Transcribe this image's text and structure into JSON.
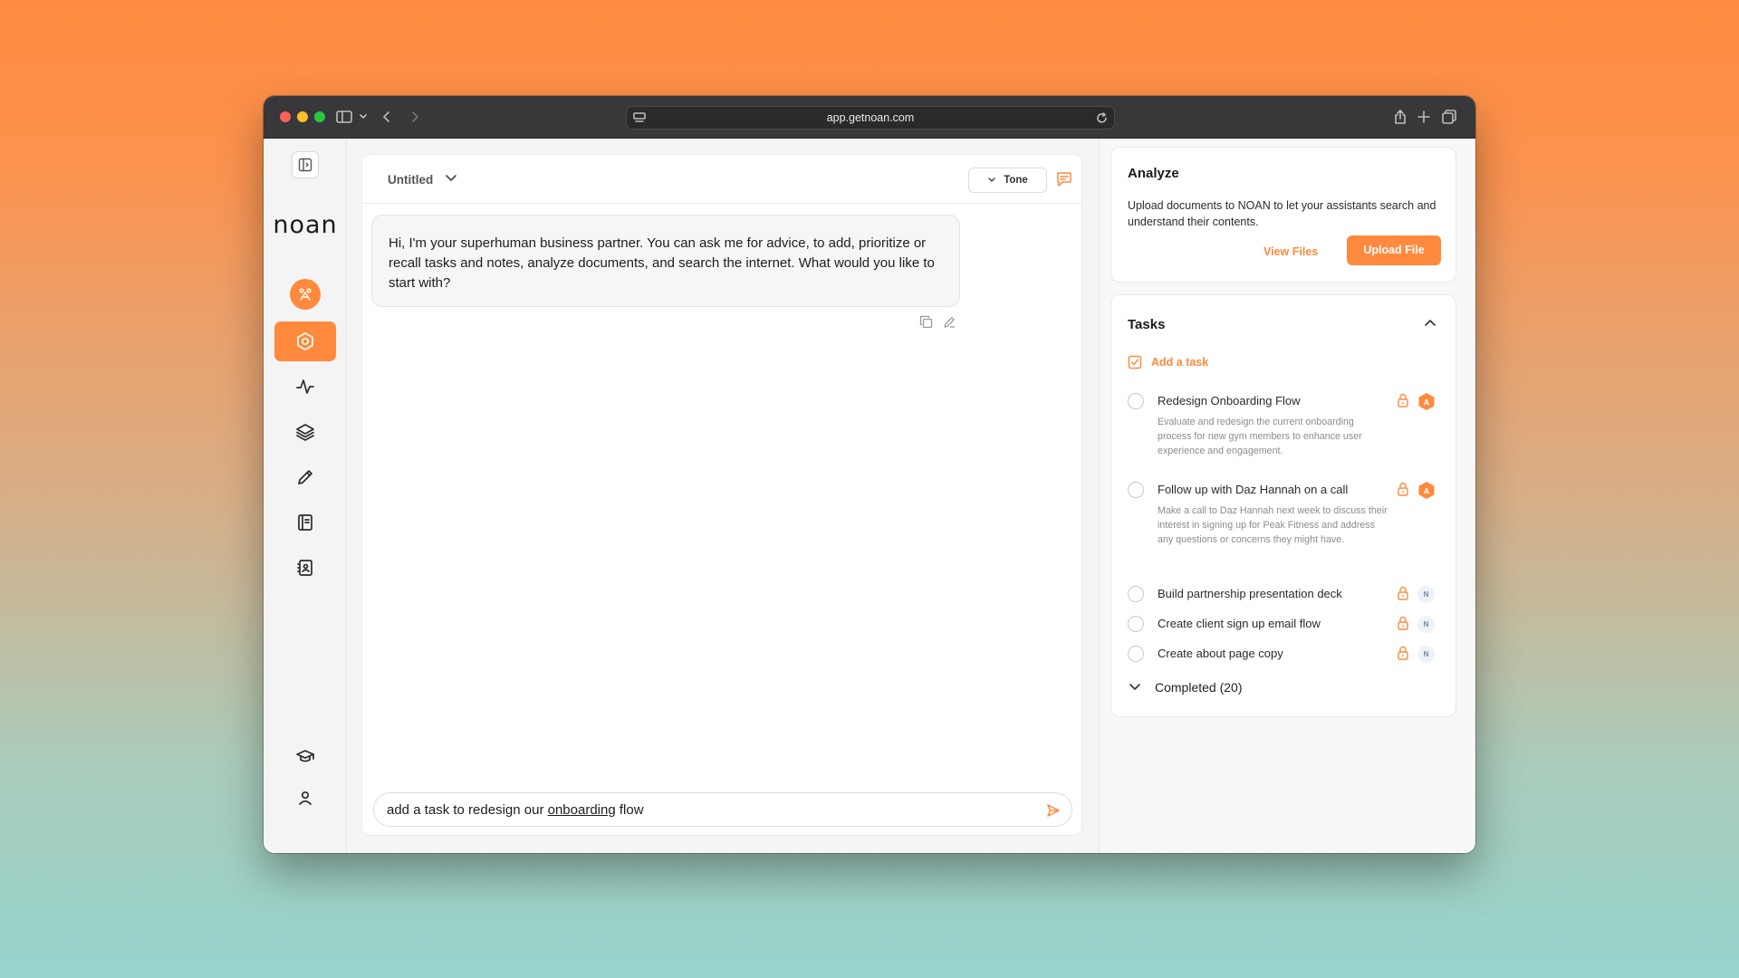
{
  "browser": {
    "url": "app.getnoan.com",
    "icons": [
      "sidebar-icon",
      "chevron-down-icon",
      "back-icon",
      "forward-icon",
      "site-icon",
      "reload-icon",
      "share-icon",
      "new-tab-icon",
      "tabs-icon"
    ]
  },
  "app": {
    "logo": "noan",
    "nav_icons": [
      "sidebar-toggle-icon",
      "assistant-icon",
      "hexagon-icon",
      "activity-icon",
      "layers-icon",
      "pencil-icon",
      "notebook-icon",
      "contacts-icon",
      "graduation-cap-icon",
      "user-icon"
    ],
    "active_nav": "hexagon-icon",
    "accent_color": "#ff8a3d"
  },
  "chat": {
    "title": "Untitled",
    "tone_label": "Tone",
    "message": "Hi, I'm your superhuman business partner. You can ask me for advice, to add, prioritize or recall tasks and notes, analyze documents, and search the internet. What would you like to start with?",
    "input_before": "add a task to redesign our ",
    "input_underlined": "onboarding",
    "input_after": " flow"
  },
  "analyze": {
    "title": "Analyze",
    "description": "Upload documents to NOAN to let your assistants search and understand their contents.",
    "view_files": "View Files",
    "upload_file": "Upload File"
  },
  "tasks": {
    "title": "Tasks",
    "add_task": "Add a task",
    "items": [
      {
        "title": "Redesign Onboarding Flow",
        "description": "Evaluate and redesign the current onboarding process for new gym members to enhance user experience and engagement.",
        "assignee": "A"
      },
      {
        "title": "Follow up with Daz Hannah on a call",
        "description": "Make a call to Daz Hannah next week to discuss their interest in signing up for Peak Fitness and address any questions or concerns they might have.",
        "assignee": "A"
      },
      {
        "title": "Build partnership presentation deck",
        "description": "",
        "assignee": "N"
      },
      {
        "title": "Create client sign up email flow",
        "description": "",
        "assignee": "N"
      },
      {
        "title": "Create about page copy",
        "description": "",
        "assignee": "N"
      }
    ],
    "completed_label": "Completed (20)"
  }
}
